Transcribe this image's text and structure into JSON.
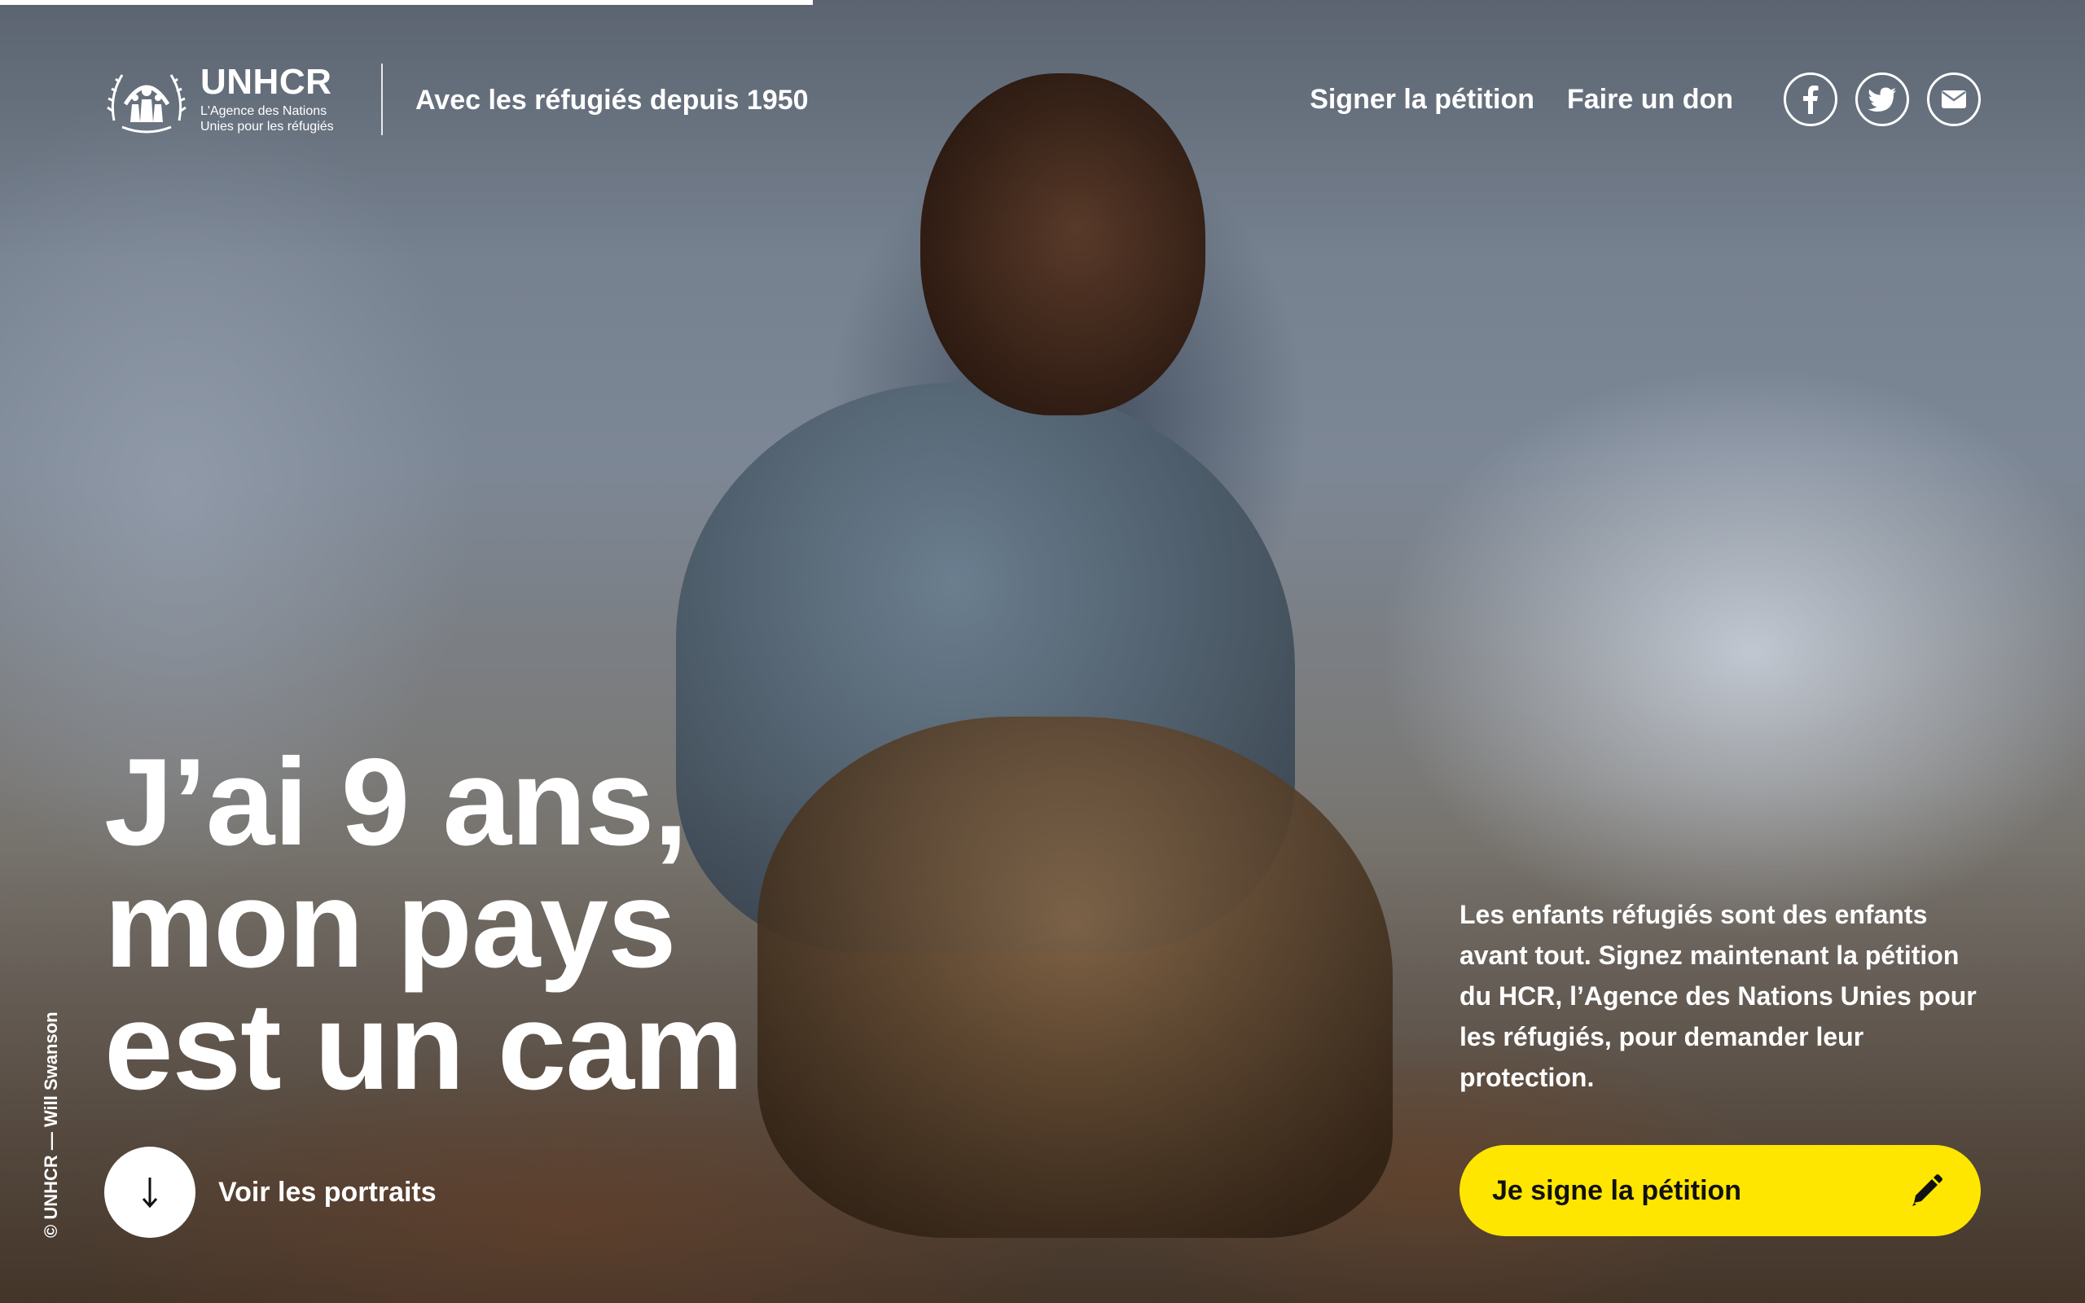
{
  "header": {
    "logo": {
      "name": "UNHCR",
      "subtitle_line1": "L'Agence des Nations",
      "subtitle_line2": "Unies pour les réfugiés",
      "icon": "unhcr-emblem-icon"
    },
    "tagline": "Avec les réfugiés depuis 1950",
    "nav": {
      "petition_label": "Signer la pétition",
      "donate_label": "Faire un don"
    },
    "social": [
      {
        "name": "facebook-icon"
      },
      {
        "name": "twitter-icon"
      },
      {
        "name": "mail-icon"
      }
    ]
  },
  "progress": {
    "fraction": 0.39
  },
  "hero": {
    "headline_line1": "J’ai 9 ans,",
    "headline_line2": "mon pays",
    "headline_line3": "est un cam",
    "photo_credit": "© UNHCR — Will Swanson",
    "portraits_label": "Voir les portraits",
    "portraits_icon": "arrow-down-icon",
    "intro_text": "Les enfants réfugiés sont des enfants avant tout. Signez maintenant la pétition du HCR, l’Agence des Nations Unies pour les réfugiés, pour demander leur protection.",
    "cta_label": "Je signe la pétition",
    "cta_icon": "pencil-icon"
  },
  "colors": {
    "accent": "#ffe600",
    "text": "#ffffff",
    "cta_text": "#111111"
  }
}
